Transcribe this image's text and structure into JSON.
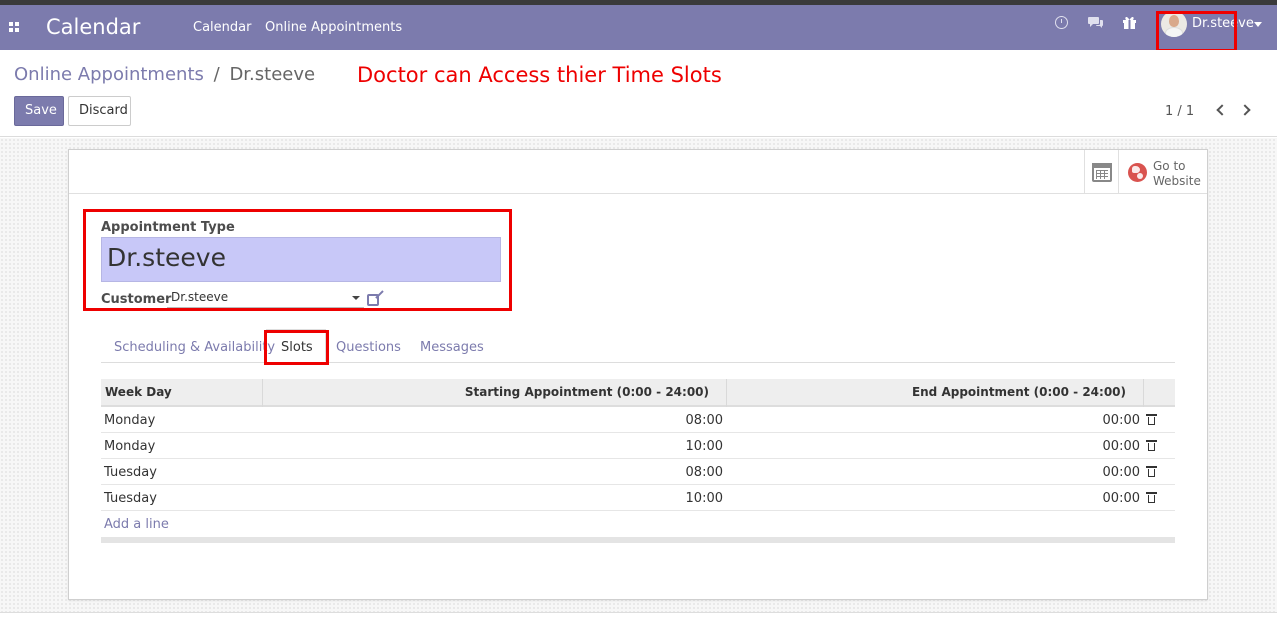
{
  "navbar": {
    "app_title": "Calendar",
    "menu": [
      "Calendar",
      "Online Appointments"
    ],
    "user_name": "Dr.steeve"
  },
  "annotation": "Doctor can Access thier Time Slots",
  "breadcrumb": {
    "parent": "Online Appointments",
    "separator": "/",
    "current": "Dr.steeve"
  },
  "actions": {
    "save": "Save",
    "discard": "Discard"
  },
  "pager": {
    "value": "1 / 1"
  },
  "button_box": {
    "website_label_line1": "Go to",
    "website_label_line2": "Website"
  },
  "form": {
    "title_label": "Appointment Type",
    "title_value": "Dr.steeve",
    "customer_label": "Customer",
    "customer_value": "Dr.steeve"
  },
  "tabs": [
    "Scheduling & Availability",
    "Slots",
    "Questions",
    "Messages"
  ],
  "slots_table": {
    "columns": [
      "Week Day",
      "Starting Appointment (0:00 - 24:00)",
      "End Appointment (0:00 - 24:00)"
    ],
    "rows": [
      [
        "Monday",
        "08:00",
        "00:00"
      ],
      [
        "Monday",
        "10:00",
        "00:00"
      ],
      [
        "Tuesday",
        "08:00",
        "00:00"
      ],
      [
        "Tuesday",
        "10:00",
        "00:00"
      ]
    ],
    "add_line": "Add a line"
  },
  "colors": {
    "brand": "#7c7bad",
    "annotation": "#ee0000",
    "title_field_bg": "#c8c8f8"
  }
}
